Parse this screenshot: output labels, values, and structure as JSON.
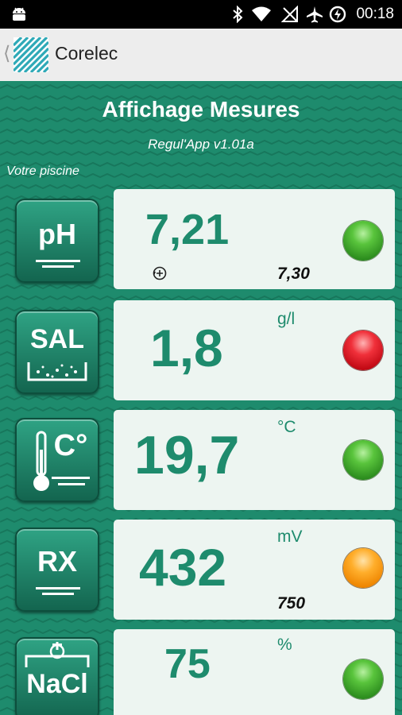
{
  "status_bar": {
    "time": "00:18",
    "icons": [
      "android-icon",
      "bluetooth-icon",
      "wifi-icon",
      "signal-off-icon",
      "airplane-icon",
      "battery-charging-icon"
    ]
  },
  "action_bar": {
    "title": "Corelec",
    "back_icon": "chevron-left-icon",
    "logo_icon": "corelec-logo-icon"
  },
  "screen": {
    "title": "Affichage Mesures",
    "version": "Regul'App v1.01a",
    "section_label": "Votre piscine"
  },
  "measurements": [
    {
      "id": "ph",
      "tile_label": "pH",
      "value": "7,21",
      "unit": "",
      "setpoint": "7,30",
      "status": "green",
      "status_color": "#3aa52a",
      "extra_icon": "regulation-icon"
    },
    {
      "id": "sal",
      "tile_label": "SAL",
      "value": "1,8",
      "unit": "g/l",
      "setpoint": "",
      "status": "red",
      "status_color": "#e0101c"
    },
    {
      "id": "temp",
      "tile_label": "C°",
      "value": "19,7",
      "unit": "°C",
      "setpoint": "",
      "status": "green",
      "status_color": "#3aa52a"
    },
    {
      "id": "rx",
      "tile_label": "RX",
      "value": "432",
      "unit": "mV",
      "setpoint": "750",
      "status": "orange",
      "status_color": "#f39a12"
    },
    {
      "id": "nacl",
      "tile_label": "NaCl",
      "value": "75",
      "unit": "%",
      "setpoint": "",
      "status": "green",
      "status_color": "#3aa52a"
    }
  ],
  "colors": {
    "background_green": "#1e8b6d",
    "value_green": "#1e8b6d",
    "card_background": "#edf5f1"
  }
}
